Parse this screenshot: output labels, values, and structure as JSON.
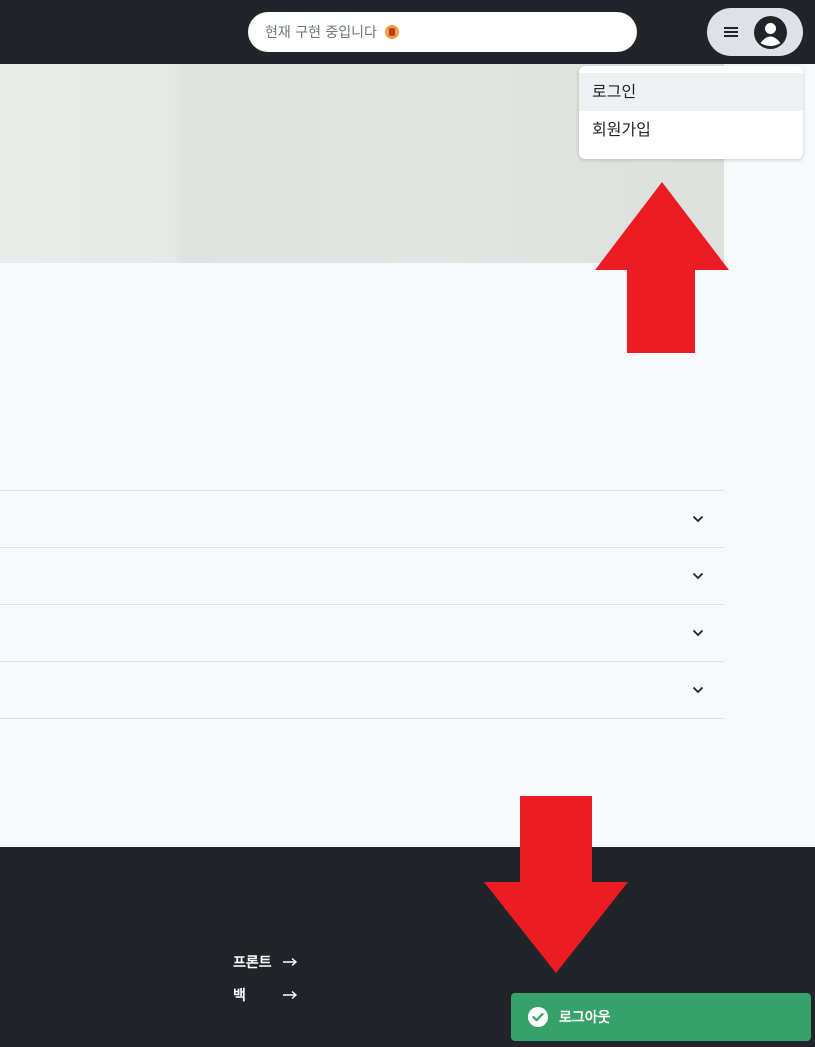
{
  "header": {
    "search": {
      "placeholder": "현재 구현 중입니다"
    },
    "menu_icon": "hamburger-icon",
    "avatar_icon": "user-avatar-icon"
  },
  "dropdown": {
    "items": [
      {
        "label": "로그인"
      },
      {
        "label": "회원가입"
      }
    ]
  },
  "accordion": {
    "items": [
      {
        "icon": "chevron-down-icon"
      },
      {
        "icon": "chevron-down-icon"
      },
      {
        "icon": "chevron-down-icon"
      },
      {
        "icon": "chevron-down-icon"
      }
    ]
  },
  "footer": {
    "links": [
      {
        "label": "프론트",
        "icon": "arrow-right-icon"
      },
      {
        "label": "백",
        "icon": "arrow-right-icon"
      }
    ]
  },
  "toast": {
    "message": "로그아웃",
    "icon": "check-circle-icon",
    "color": "#38a169"
  },
  "annotations": {
    "arrow_color": "#ed1c24"
  }
}
